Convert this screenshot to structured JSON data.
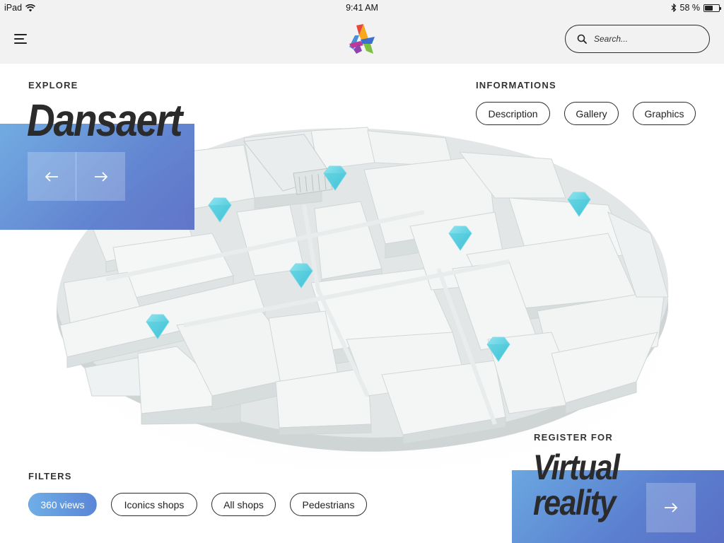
{
  "status_bar": {
    "device": "iPad",
    "time": "9:41 AM",
    "battery": "58 %",
    "battery_level": 0.58
  },
  "header": {
    "search_placeholder": "Search..."
  },
  "explore": {
    "label": "EXPLORE",
    "title": "Dansaert"
  },
  "informations": {
    "label": "INFORMATIONS",
    "buttons": [
      "Description",
      "Gallery",
      "Graphics"
    ]
  },
  "filters": {
    "label": "FILTERS",
    "items": [
      "360 views",
      "Iconics shops",
      "All shops",
      "Pedestrians"
    ],
    "active": "360 views"
  },
  "register": {
    "label": "REGISTER FOR",
    "title_line1": "Virtual",
    "title_line2": "reality"
  },
  "colors": {
    "accent_blue_light": "#6aa7e0",
    "accent_blue_dark": "#5a6fc6",
    "marker": "#5fd0e0",
    "header_bg": "#f2f2f2"
  },
  "icons": {
    "menu": "hamburger-icon",
    "logo": "app-logo",
    "search": "search-icon",
    "prev": "arrow-left-icon",
    "next": "arrow-right-icon",
    "marker": "location-marker-icon"
  }
}
